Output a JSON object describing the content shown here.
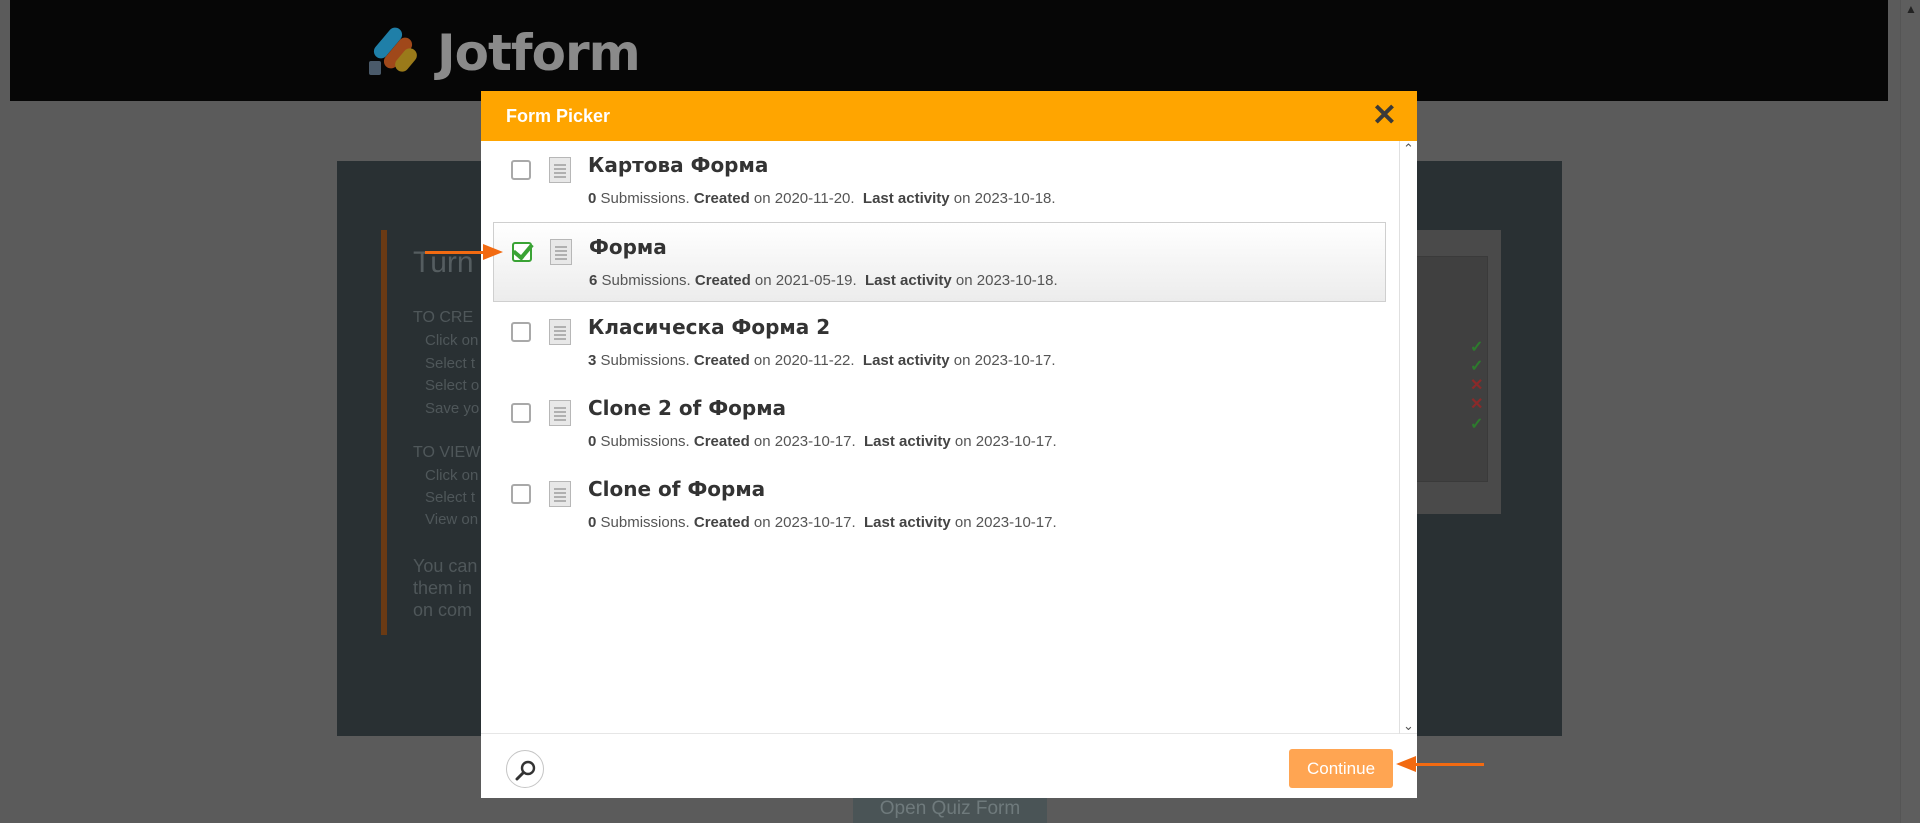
{
  "app": {
    "brand": "Jotform"
  },
  "background": {
    "heading": "Turn",
    "section1_title": "TO CRE",
    "section1_items": [
      "Click on",
      "Select t",
      "Select o",
      "Save yo"
    ],
    "section2_title": "TO VIEW",
    "section2_items": [
      "Click on",
      "Select t",
      "View on"
    ],
    "paragraph": [
      "You can",
      "them in",
      "on com"
    ],
    "bottom_button": "Open Quiz Form"
  },
  "modal": {
    "title": "Form Picker",
    "close_icon": "close-icon",
    "forms": [
      {
        "name": "Картова Форма",
        "submissions": "0",
        "submissions_label": "Submissions.",
        "created_label": "Created",
        "created": "on 2020-11-20.",
        "activity_label": "Last activity",
        "activity": "on 2023-10-18.",
        "checked": false
      },
      {
        "name": "Форма",
        "submissions": "6",
        "submissions_label": "Submissions.",
        "created_label": "Created",
        "created": "on 2021-05-19.",
        "activity_label": "Last activity",
        "activity": "on 2023-10-18.",
        "checked": true
      },
      {
        "name": "Класическа Форма 2",
        "submissions": "3",
        "submissions_label": "Submissions.",
        "created_label": "Created",
        "created": "on 2020-11-22.",
        "activity_label": "Last activity",
        "activity": "on 2023-10-17.",
        "checked": false
      },
      {
        "name": "Clone 2 of Форма",
        "submissions": "0",
        "submissions_label": "Submissions.",
        "created_label": "Created",
        "created": "on 2023-10-17.",
        "activity_label": "Last activity",
        "activity": "on 2023-10-17.",
        "checked": false
      },
      {
        "name": "Clone of Форма",
        "submissions": "0",
        "submissions_label": "Submissions.",
        "created_label": "Created",
        "created": "on 2023-10-17.",
        "activity_label": "Last activity",
        "activity": "on 2023-10-17.",
        "checked": false
      }
    ],
    "continue_label": "Continue"
  },
  "colors": {
    "header": "#ffa500",
    "continue": "#ffa552",
    "check": "#3aa335",
    "annotation": "#f26a11"
  }
}
